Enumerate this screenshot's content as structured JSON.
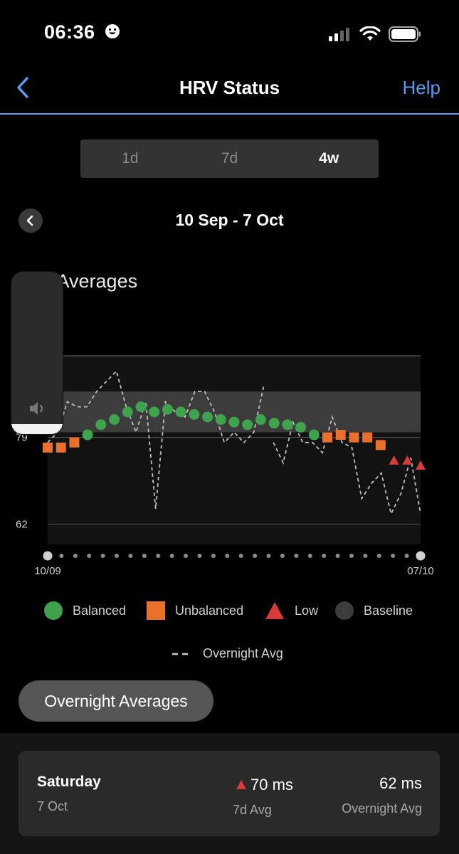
{
  "status_bar": {
    "time": "06:36"
  },
  "nav": {
    "title": "HRV Status",
    "help": "Help"
  },
  "tabs": [
    {
      "label": "1d",
      "active": false
    },
    {
      "label": "7d",
      "active": false
    },
    {
      "label": "4w",
      "active": true
    }
  ],
  "date_range": "10 Sep - 7 Oct",
  "chart_title": "7-Day Averages",
  "chart_title_visible": "y Averages",
  "volume": {
    "level": 0.06
  },
  "colors": {
    "balanced": "#3fa34d",
    "unbalanced": "#e8702a",
    "low": "#d83a3a",
    "baseline": "#3c3c3c",
    "accent": "#5b9cf0"
  },
  "chart_data": {
    "type": "scatter",
    "x_start_label": "10/09",
    "x_end_label": "07/10",
    "ylim": [
      58,
      95
    ],
    "y_ticks": [
      62,
      79
    ],
    "baseline_band": {
      "lower": 80,
      "upper": 88
    },
    "points": [
      {
        "day": 1,
        "y": 77,
        "status": "Unbalanced"
      },
      {
        "day": 2,
        "y": 77,
        "status": "Unbalanced"
      },
      {
        "day": 3,
        "y": 78,
        "status": "Unbalanced"
      },
      {
        "day": 4,
        "y": 79.5,
        "status": "Balanced"
      },
      {
        "day": 5,
        "y": 81.5,
        "status": "Balanced"
      },
      {
        "day": 6,
        "y": 82.5,
        "status": "Balanced"
      },
      {
        "day": 7,
        "y": 84,
        "status": "Balanced"
      },
      {
        "day": 8,
        "y": 85,
        "status": "Balanced"
      },
      {
        "day": 9,
        "y": 84,
        "status": "Balanced"
      },
      {
        "day": 10,
        "y": 84.5,
        "status": "Balanced"
      },
      {
        "day": 11,
        "y": 84,
        "status": "Balanced"
      },
      {
        "day": 12,
        "y": 83.5,
        "status": "Balanced"
      },
      {
        "day": 13,
        "y": 83,
        "status": "Balanced"
      },
      {
        "day": 14,
        "y": 82.5,
        "status": "Balanced"
      },
      {
        "day": 15,
        "y": 82,
        "status": "Balanced"
      },
      {
        "day": 16,
        "y": 81.5,
        "status": "Balanced"
      },
      {
        "day": 17,
        "y": 82.5,
        "status": "Balanced"
      },
      {
        "day": 18,
        "y": 81.8,
        "status": "Balanced"
      },
      {
        "day": 19,
        "y": 81.5,
        "status": "Balanced"
      },
      {
        "day": 20,
        "y": 81,
        "status": "Balanced"
      },
      {
        "day": 21,
        "y": 79.5,
        "status": "Balanced"
      },
      {
        "day": 22,
        "y": 79,
        "status": "Unbalanced"
      },
      {
        "day": 23,
        "y": 79.5,
        "status": "Unbalanced"
      },
      {
        "day": 24,
        "y": 79,
        "status": "Unbalanced"
      },
      {
        "day": 25,
        "y": 79,
        "status": "Unbalanced"
      },
      {
        "day": 26,
        "y": 77.5,
        "status": "Unbalanced"
      },
      {
        "day": 27,
        "y": 74.5,
        "status": "Low"
      },
      {
        "day": 28,
        "y": 74.5,
        "status": "Low"
      },
      {
        "day": 29,
        "y": 73.5,
        "status": "Low"
      }
    ],
    "overnight_avg": [
      78,
      80,
      86,
      85,
      85,
      88,
      90,
      92,
      85,
      80,
      86,
      65,
      86,
      84,
      83,
      88,
      88,
      84,
      78,
      80,
      78,
      80,
      89,
      78,
      74,
      82,
      78,
      78,
      76,
      83,
      78,
      77,
      67,
      70,
      72,
      64,
      68,
      75,
      64
    ],
    "overnight_avg_gap_after": [
      22
    ],
    "legend": [
      "Balanced",
      "Unbalanced",
      "Low",
      "Baseline",
      "Overnight Avg"
    ]
  },
  "overnight_button": "Overnight Averages",
  "summary": {
    "day": "Saturday",
    "date": "7 Oct",
    "avg7_value": "70 ms",
    "avg7_label": "7d Avg",
    "overnight_value": "62 ms",
    "overnight_label": "Overnight Avg"
  }
}
